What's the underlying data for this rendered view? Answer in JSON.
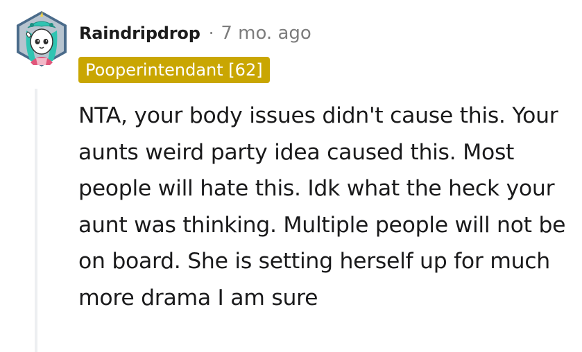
{
  "comment": {
    "author": "Raindripdrop",
    "separator": "·",
    "timestamp": "7 mo. ago",
    "flair": "Pooperintendant [62]",
    "flair_color": "#c9a602",
    "body": "NTA, your body issues didn't cause this. Your aunts weird party idea caused this. Most people will hate this. Idk what the heck your aunt was thinking. Multiple people will not be on board. She is setting herself up for much more drama I am sure",
    "avatar_icon": "snoo-unicorn-avatar-icon"
  }
}
